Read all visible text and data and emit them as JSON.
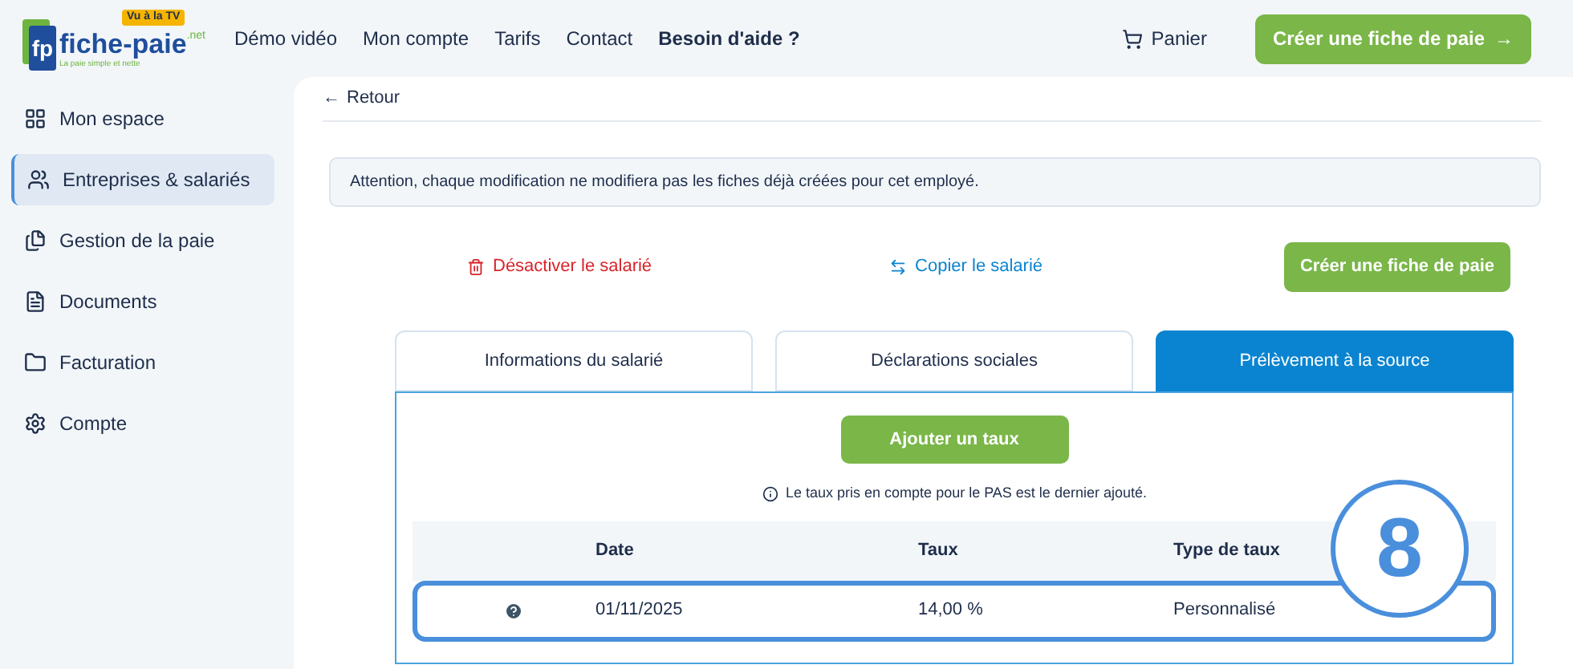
{
  "logo": {
    "mark": "fp",
    "name": "fiche-paie",
    "suffix": ".net",
    "badge": "Vu à la TV",
    "tagline": "La paie simple et nette"
  },
  "nav": [
    {
      "label": "Démo vidéo",
      "bold": false
    },
    {
      "label": "Mon compte",
      "bold": false
    },
    {
      "label": "Tarifs",
      "bold": false
    },
    {
      "label": "Contact",
      "bold": false
    },
    {
      "label": "Besoin d'aide ?",
      "bold": true
    }
  ],
  "cart": {
    "label": "Panier"
  },
  "header_button": {
    "label": "Créer une fiche de paie",
    "arrow": "→"
  },
  "sidebar": {
    "items": [
      {
        "label": "Mon espace",
        "kind": "grid",
        "selected": false
      },
      {
        "label": "Entreprises & salariés",
        "kind": "users",
        "selected": true
      },
      {
        "label": "Gestion de la paie",
        "kind": "files",
        "selected": false
      },
      {
        "label": "Documents",
        "kind": "doc",
        "selected": false
      },
      {
        "label": "Facturation",
        "kind": "folder",
        "selected": false
      },
      {
        "label": "Compte",
        "kind": "gear",
        "selected": false
      }
    ]
  },
  "back": {
    "arrow": "←",
    "label": "Retour"
  },
  "notice": "Attention, chaque modification ne modifiera pas les fiches déjà créées pour cet employé.",
  "actions": {
    "deactivate": "Désactiver le salarié",
    "copy": "Copier le salarié",
    "create": "Créer une fiche de paie"
  },
  "tabs": [
    {
      "label": "Informations du salarié",
      "selected": false
    },
    {
      "label": "Déclarations sociales",
      "selected": false
    },
    {
      "label": "Prélèvement à la source",
      "selected": true
    }
  ],
  "add_button": "Ajouter un taux",
  "info": "Le taux pris en compte pour le PAS est le dernier ajouté.",
  "table": {
    "columns": [
      "Date",
      "Taux",
      "Type de taux"
    ],
    "rows": [
      {
        "date": "01/11/2025",
        "rate": "14,00 %",
        "type": "Personnalisé",
        "highlighted": true
      }
    ]
  },
  "callout": {
    "number": "8"
  }
}
